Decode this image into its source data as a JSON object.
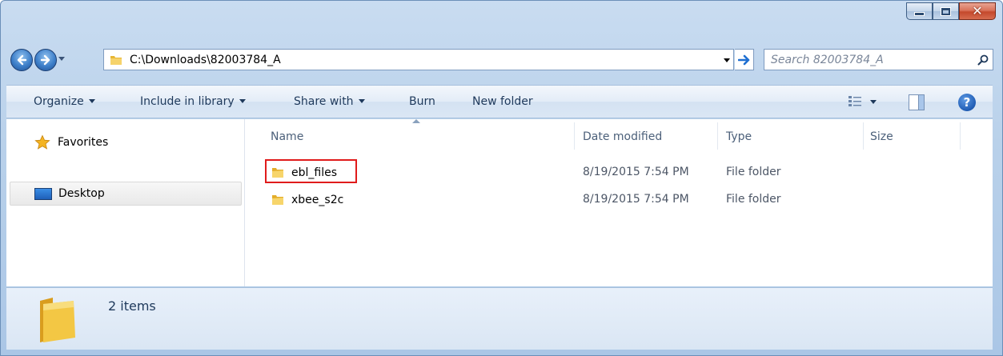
{
  "window": {
    "caption_buttons": {
      "minimize_icon": "minimize-icon",
      "maximize_icon": "maximize-icon",
      "close_glyph": "✕"
    }
  },
  "address_bar": {
    "path": "C:\\Downloads\\82003784_A",
    "search_placeholder": "Search 82003784_A"
  },
  "toolbar": {
    "organize": "Organize",
    "include_in_library": "Include in library",
    "share_with": "Share with",
    "burn": "Burn",
    "new_folder": "New folder",
    "help": "?"
  },
  "nav_pane": {
    "items": [
      {
        "label": "Favorites",
        "icon": "star-icon"
      },
      {
        "label": "Desktop",
        "icon": "desktop-icon"
      }
    ]
  },
  "columns": {
    "name": "Name",
    "date_modified": "Date modified",
    "type": "Type",
    "size": "Size"
  },
  "files": [
    {
      "name": "ebl_files",
      "date": "8/19/2015 7:54 PM",
      "type": "File folder",
      "size": ""
    },
    {
      "name": "xbee_s2c",
      "date": "8/19/2015 7:54 PM",
      "type": "File folder",
      "size": ""
    }
  ],
  "status": {
    "item_count": "2 items"
  },
  "colors": {
    "folder": "#f2c94c",
    "highlight": "#e01b1b",
    "accent": "#1e5fb8"
  }
}
